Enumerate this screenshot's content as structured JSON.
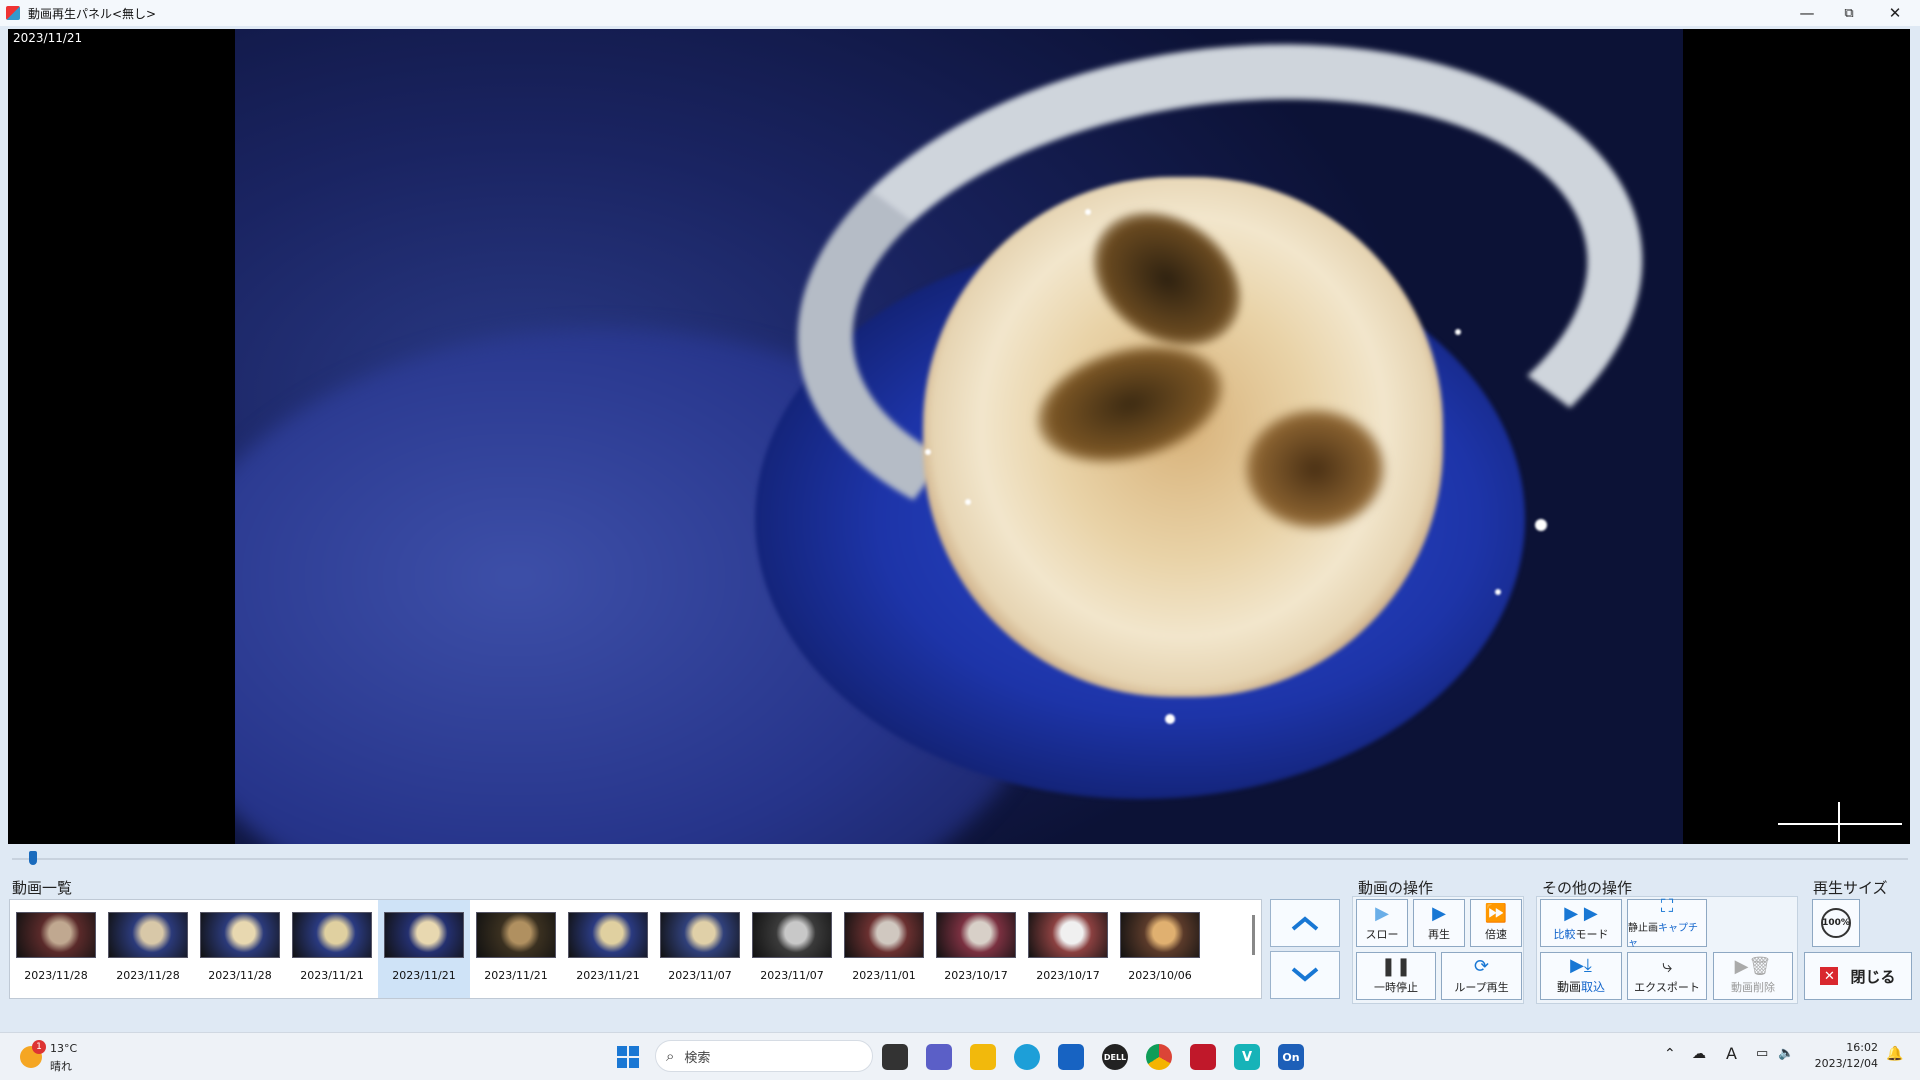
{
  "window": {
    "title": "動画再生パネル<無し>",
    "minimize": "—",
    "restore": "⧉",
    "close": "✕"
  },
  "video": {
    "date": "2023/11/21",
    "position_fraction": 0.009
  },
  "video_list": {
    "label": "動画一覧",
    "items": [
      {
        "date": "2023/11/28",
        "selected": false
      },
      {
        "date": "2023/11/28",
        "selected": false
      },
      {
        "date": "2023/11/28",
        "selected": false
      },
      {
        "date": "2023/11/21",
        "selected": false
      },
      {
        "date": "2023/11/21",
        "selected": true
      },
      {
        "date": "2023/11/21",
        "selected": false
      },
      {
        "date": "2023/11/21",
        "selected": false
      },
      {
        "date": "2023/11/07",
        "selected": false
      },
      {
        "date": "2023/11/07",
        "selected": false
      },
      {
        "date": "2023/11/01",
        "selected": false
      },
      {
        "date": "2023/10/17",
        "selected": false
      },
      {
        "date": "2023/10/17",
        "selected": false
      },
      {
        "date": "2023/10/06",
        "selected": false
      }
    ]
  },
  "nav": {
    "up_icon": "chevron-up-icon",
    "down_icon": "chevron-down-icon"
  },
  "video_ops": {
    "label": "動画の操作",
    "slow": "スロー",
    "play": "再生",
    "fast": "倍速",
    "pause": "一時停止",
    "loop": "ループ再生"
  },
  "other_ops": {
    "label": "その他の操作",
    "compare_a": "比較",
    "compare_b": "モード",
    "capture_a": "静止画",
    "capture_b": "キャプチャ",
    "import_a": "動画",
    "import_b": "取込",
    "export": "エクスポート",
    "delete": "動画削除"
  },
  "play_size": {
    "label": "再生サイズ",
    "zoom": "100%"
  },
  "close_button": "閉じる",
  "taskbar": {
    "weather_temp": "13°C",
    "weather_desc": "晴れ",
    "weather_badge": "1",
    "search_placeholder": "検索",
    "clock_time": "16:02",
    "clock_date": "2023/12/04"
  },
  "colors": {
    "accent": "#1877d4",
    "close_red": "#d9272e",
    "selected_row": "#cfe3f7"
  }
}
